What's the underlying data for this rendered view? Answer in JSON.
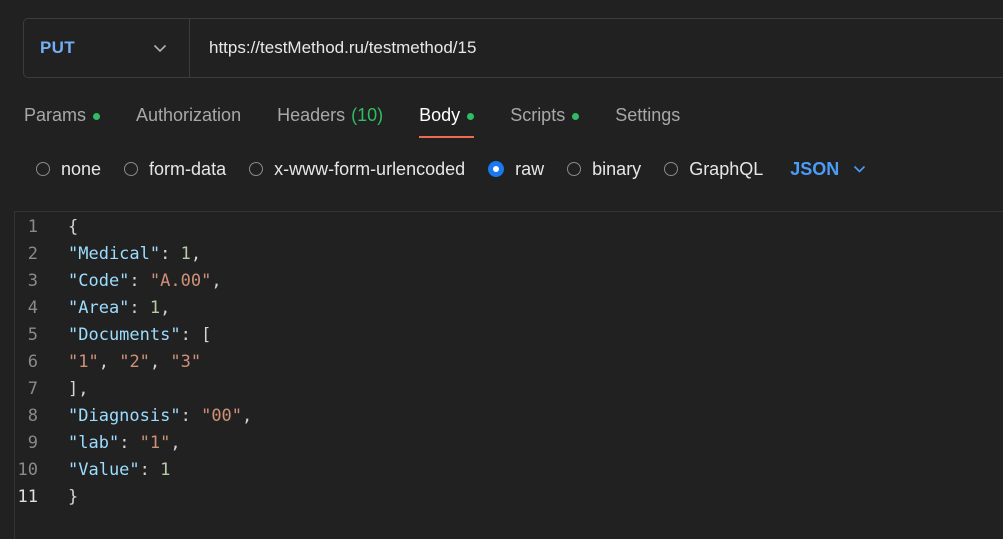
{
  "request": {
    "method": "PUT",
    "url": "https://testMethod.ru/testmethod/15"
  },
  "tabs": [
    {
      "label": "Params",
      "dot": true
    },
    {
      "label": "Authorization",
      "dot": false
    },
    {
      "label": "Headers",
      "count": "(10)",
      "dot": false
    },
    {
      "label": "Body",
      "dot": true,
      "active": true
    },
    {
      "label": "Scripts",
      "dot": true
    },
    {
      "label": "Settings",
      "dot": false
    }
  ],
  "body_types": [
    {
      "label": "none",
      "checked": false
    },
    {
      "label": "form-data",
      "checked": false
    },
    {
      "label": "x-www-form-urlencoded",
      "checked": false
    },
    {
      "label": "raw",
      "checked": true
    },
    {
      "label": "binary",
      "checked": false
    },
    {
      "label": "GraphQL",
      "checked": false
    }
  ],
  "language": "JSON",
  "editor": {
    "current_line": 11,
    "lines": [
      [
        {
          "t": "p",
          "v": "{"
        }
      ],
      [
        {
          "t": "k",
          "v": "\"Medical\""
        },
        {
          "t": "p",
          "v": ": "
        },
        {
          "t": "n",
          "v": "1"
        },
        {
          "t": "p",
          "v": ","
        }
      ],
      [
        {
          "t": "k",
          "v": "\"Code\""
        },
        {
          "t": "p",
          "v": ": "
        },
        {
          "t": "s",
          "v": "\"A.00\""
        },
        {
          "t": "p",
          "v": ","
        }
      ],
      [
        {
          "t": "k",
          "v": "\"Area\""
        },
        {
          "t": "p",
          "v": ": "
        },
        {
          "t": "n",
          "v": "1"
        },
        {
          "t": "p",
          "v": ","
        }
      ],
      [
        {
          "t": "k",
          "v": "\"Documents\""
        },
        {
          "t": "p",
          "v": ": ["
        }
      ],
      [
        {
          "t": "s",
          "v": "\"1\""
        },
        {
          "t": "p",
          "v": ", "
        },
        {
          "t": "s",
          "v": "\"2\""
        },
        {
          "t": "p",
          "v": ", "
        },
        {
          "t": "s",
          "v": "\"3\""
        }
      ],
      [
        {
          "t": "p",
          "v": "],"
        }
      ],
      [
        {
          "t": "k",
          "v": "\"Diagnosis\""
        },
        {
          "t": "p",
          "v": ": "
        },
        {
          "t": "s",
          "v": "\"00\""
        },
        {
          "t": "p",
          "v": ","
        }
      ],
      [
        {
          "t": "k",
          "v": "\"lab\""
        },
        {
          "t": "p",
          "v": ": "
        },
        {
          "t": "s",
          "v": "\"1\""
        },
        {
          "t": "p",
          "v": ","
        }
      ],
      [
        {
          "t": "k",
          "v": "\"Value\""
        },
        {
          "t": "p",
          "v": ": "
        },
        {
          "t": "n",
          "v": "1"
        }
      ],
      [
        {
          "t": "p",
          "v": "}"
        }
      ]
    ]
  },
  "colors": {
    "background": "#212121",
    "method": "#74aef6",
    "active_tab_underline": "#ee6c4d",
    "dot": "#2ebd62",
    "radio_checked": "#1a78f0",
    "language": "#4a9cf7",
    "json_key": "#9cdcfe",
    "json_string": "#ce9178",
    "json_number": "#b5cea8"
  }
}
